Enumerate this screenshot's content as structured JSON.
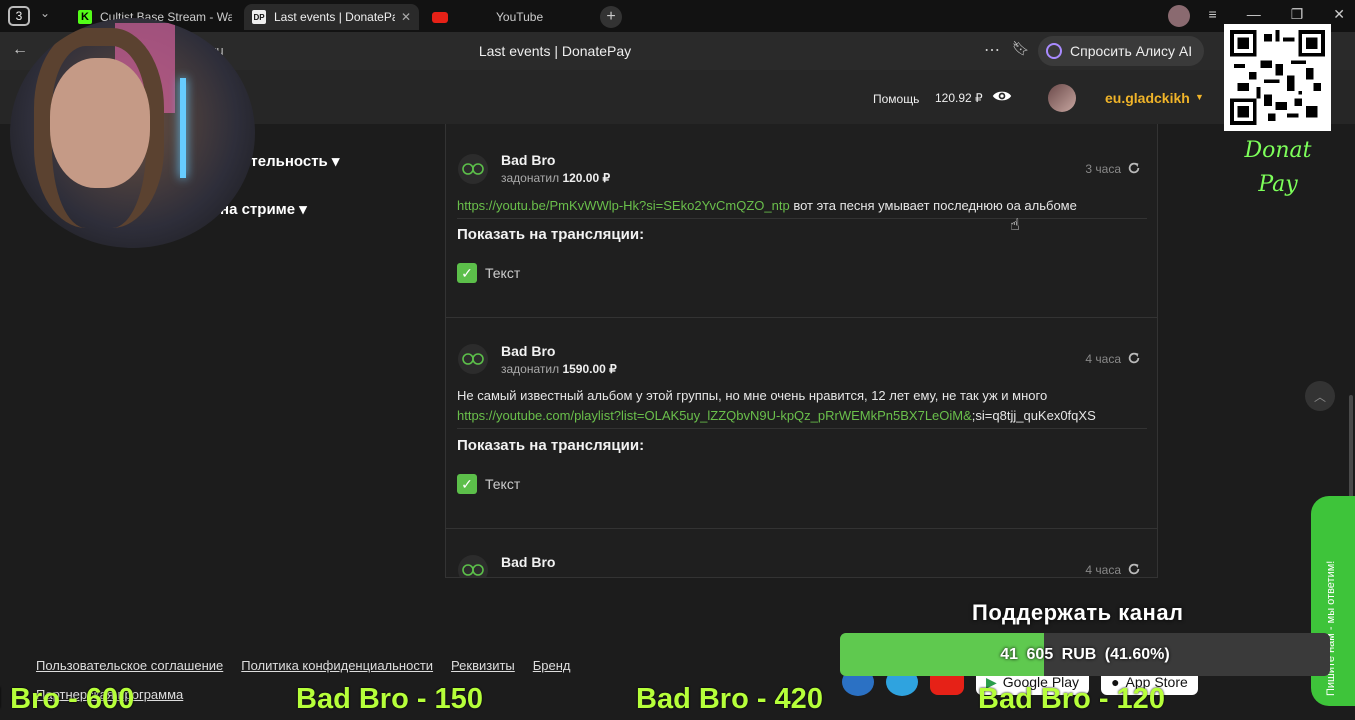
{
  "browser": {
    "tab_count": "3",
    "tabs": [
      {
        "title": "Cultist Base Stream - Watch",
        "favicon": "K",
        "active": false
      },
      {
        "title": "Last events | DonatePay",
        "favicon": "DP",
        "active": true
      },
      {
        "title": "YouTube",
        "favicon": "yt",
        "active": false
      }
    ],
    "page_title": "Last events | DonatePay",
    "url_host": "ru",
    "alice_label": "Спросить Алису AI"
  },
  "header": {
    "help": "Помощь",
    "balance": "120.92 ₽",
    "username": "eu.gladckikh"
  },
  "side_menu": {
    "item1": "рительность ▾",
    "item2": "ка на стриме ▾"
  },
  "events": [
    {
      "name": "Bad Bro",
      "action": "задонатил",
      "amount": "120.00 ₽",
      "time": "3 часа",
      "link": "https://youtu.be/PmKvWWlp-Hk?si=SEko2YvCmQZO_ntp",
      "text_after": " вот эта песня умывает последнюю оа альбоме",
      "text_before": "",
      "show_label": "Показать на трансляции:",
      "checkbox_label": "Текст"
    },
    {
      "name": "Bad Bro",
      "action": "задонатил",
      "amount": "1590.00 ₽",
      "time": "4 часа",
      "text_before": "Не самый известный альбом у этой группы, но мне очень нравится, 12 лет ему, не так уж и много",
      "link": "https://youtube.com/playlist?list=OLAK5uy_lZZQbvN9U-kpQz_pRrWEMkPn5BX7LeOiM&",
      "text_after": ";si=q8tjj_quKex0fqXS",
      "show_label": "Показать на трансляции:",
      "checkbox_label": "Текст"
    },
    {
      "name": "Bad Bro",
      "time": "4 часа"
    }
  ],
  "footer": {
    "links": [
      "Пользовательское соглашение",
      "Политика конфиденциальности",
      "Реквизиты",
      "Бренд"
    ],
    "partner": "Партнерская программа"
  },
  "overlay": {
    "qr_caption_1": "Donat",
    "qr_caption_2": "Pay",
    "support_title": "Поддержать канал",
    "goal_text": "41 605 RUB (41.60%)",
    "goal_fraction": 0.416,
    "side_tab": "Пишите нам - мы ответим!",
    "stores": [
      "Google Play",
      "App Store"
    ],
    "ticker": [
      "l Bro - 600",
      "Bad Bro - 150",
      "Bad Bro - 420",
      "Bad Bro - 120"
    ]
  },
  "colors": {
    "accent_green": "#5cbf4a",
    "link_green": "#6abf4b",
    "username_yellow": "#f0b429",
    "ticker_green": "#b6ff3a"
  }
}
